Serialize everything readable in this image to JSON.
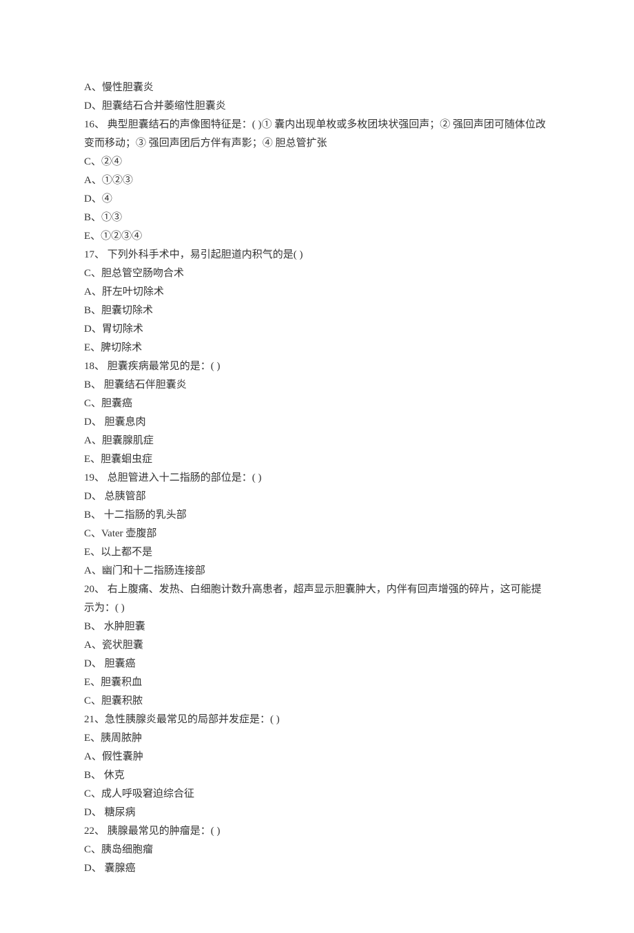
{
  "lines": [
    "A、慢性胆囊炎",
    "D、胆囊结石合并萎缩性胆囊炎",
    "16、 典型胆囊结石的声像图特征是：( )① 囊内出现单枚或多枚团块状强回声；② 强回声团可随体位改变而移动；③ 强回声团后方伴有声影；④ 胆总管扩张",
    "C、②④",
    "A、①②③",
    "D、④",
    "B、①③",
    "E、①②③④",
    "17、 下列外科手术中，易引起胆道内积气的是( )",
    "C、胆总管空肠吻合术",
    "A、肝左叶切除术",
    "B、胆囊切除术",
    "D、胃切除术",
    "E、脾切除术",
    "18、 胆囊疾病最常见的是：( )",
    "B、 胆囊结石伴胆囊炎",
    "C、胆囊癌",
    "D、 胆囊息肉",
    "A、胆囊腺肌症",
    "E、胆囊蛔虫症",
    "19、 总胆管进入十二指肠的部位是：( )",
    "D、 总胰管部",
    "B、 十二指肠的乳头部",
    "C、Vater 壶腹部",
    "E、以上都不是",
    "A、幽门和十二指肠连接部",
    "20、 右上腹痛、发热、白细胞计数升高患者，超声显示胆囊肿大，内伴有回声增强的碎片，这可能提示为：( )",
    "B、 水肿胆囊",
    "A、瓷状胆囊",
    "D、 胆囊癌",
    "E、胆囊积血",
    "C、胆囊积脓",
    "21、急性胰腺炎最常见的局部并发症是：( )",
    "E、胰周脓肿",
    "A、假性囊肿",
    "B、 休克",
    "C、成人呼吸窘迫综合征",
    "D、 糖尿病",
    "22、 胰腺最常见的肿瘤是：( )",
    "C、胰岛细胞瘤",
    "D、 囊腺癌"
  ]
}
